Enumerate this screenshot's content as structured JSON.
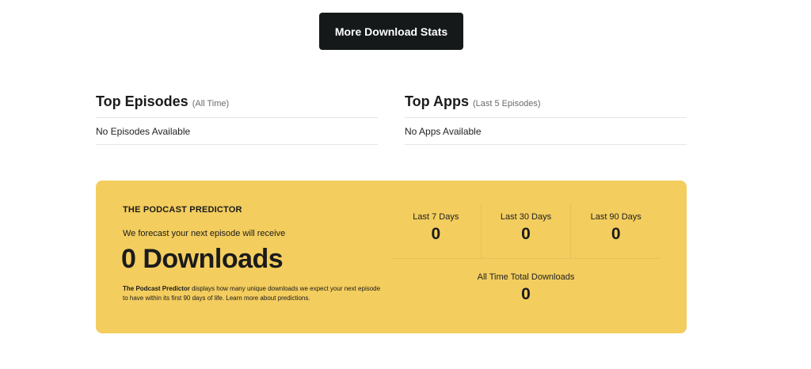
{
  "actions": {
    "more_stats_label": "More Download Stats"
  },
  "top_episodes": {
    "title": "Top Episodes",
    "subtitle": "(All Time)",
    "empty_text": "No Episodes Available"
  },
  "top_apps": {
    "title": "Top Apps",
    "subtitle": "(Last 5 Episodes)",
    "empty_text": "No Apps Available"
  },
  "predictor": {
    "heading": "THE PODCAST PREDICTOR",
    "forecast_text": "We forecast your next episode will receive",
    "forecast_value": "0 Downloads",
    "note_bold": "The Podcast Predictor",
    "note_text": " displays how many unique downloads we expect your next episode to have within its first 90 days of life. Learn more about predictions.",
    "accent_color": "#f3cd5e"
  },
  "stats": {
    "periods": [
      {
        "label": "Last 7 Days",
        "value": "0"
      },
      {
        "label": "Last 30 Days",
        "value": "0"
      },
      {
        "label": "Last 90 Days",
        "value": "0"
      }
    ],
    "all_time_label": "All Time Total Downloads",
    "all_time_value": "0"
  }
}
